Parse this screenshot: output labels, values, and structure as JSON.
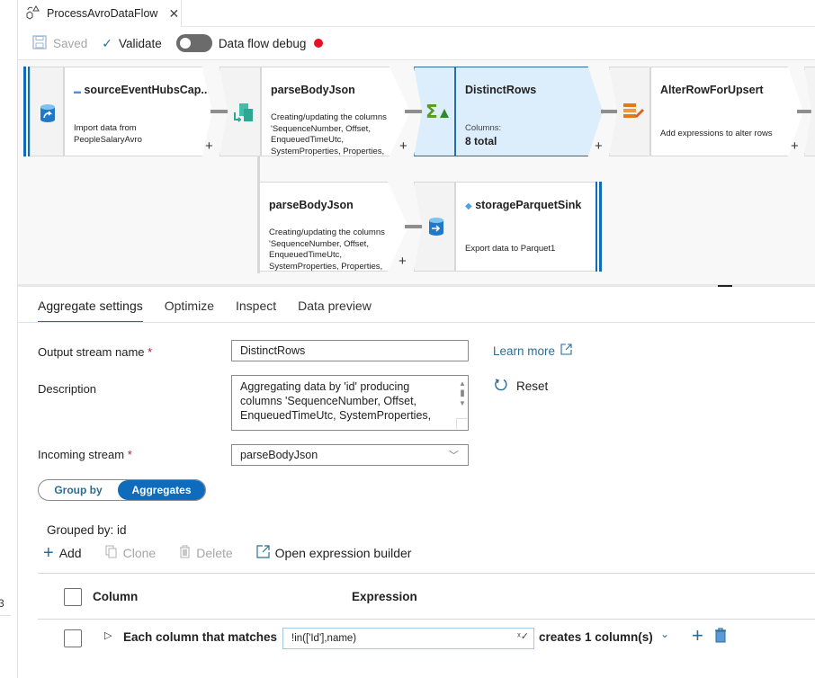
{
  "tab": {
    "title": "ProcessAvroDataFlow",
    "icon": "dataflow-icon",
    "close_icon": "close-icon"
  },
  "toolbar": {
    "saved_label": "Saved",
    "validate_label": "Validate",
    "debug_label": "Data flow debug",
    "debug_on": false,
    "debug_status_color": "#e81123"
  },
  "canvas": {
    "nodes": [
      {
        "id": "source",
        "title": "sourceEventHubsCap...",
        "desc": [
          "Import data from",
          "PeopleSalaryAvro"
        ],
        "icon": "source-database-icon"
      },
      {
        "id": "parse1",
        "title": "parseBodyJson",
        "desc": [
          "Creating/updating the columns",
          "'SequenceNumber, Offset,",
          "EnqueuedTimeUtc,",
          "SystemProperties, Properties,"
        ],
        "icon": "parse-icon"
      },
      {
        "id": "distinct",
        "title": "DistinctRows",
        "desc_label": "Columns:",
        "desc_value": "8 total",
        "icon": "aggregate-icon",
        "selected": true
      },
      {
        "id": "alterrow",
        "title": "AlterRowForUpsert",
        "desc": [
          "Add expressions to alter rows"
        ],
        "icon": "alter-row-icon"
      },
      {
        "id": "parse2",
        "title": "parseBodyJson",
        "desc": [
          "Creating/updating the columns",
          "'SequenceNumber, Offset,",
          "EnqueuedTimeUtc,",
          "SystemProperties, Properties,"
        ]
      },
      {
        "id": "sink",
        "title": "storageParquetSink",
        "desc": [
          "Export data to Parquet1"
        ],
        "icon": "sink-database-icon"
      }
    ],
    "plus_label": "+"
  },
  "panel": {
    "tabs": [
      "Aggregate settings",
      "Optimize",
      "Inspect",
      "Data preview"
    ],
    "active_tab": 0,
    "output_stream_label": "Output stream name",
    "output_stream_value": "DistinctRows",
    "required_mark": "*",
    "learn_more": "Learn more",
    "description_label": "Description",
    "description_lines": [
      "Aggregating data by 'id' producing",
      "columns 'SequenceNumber, Offset,",
      "EnqueuedTimeUtc, SystemProperties,"
    ],
    "reset_label": "Reset",
    "incoming_stream_label": "Incoming stream",
    "incoming_stream_value": "parseBodyJson",
    "segment": {
      "group_by": "Group by",
      "aggregates": "Aggregates",
      "active": "Aggregates"
    },
    "grouped_by": "Grouped by: id",
    "actions": {
      "add": "Add",
      "clone": "Clone",
      "delete": "Delete",
      "open_builder": "Open expression builder"
    },
    "table": {
      "col_column": "Column",
      "col_expression": "Expression",
      "rows": [
        {
          "label": "Each column that matches",
          "match_expr": "!in(['Id'],name)",
          "result": "creates 1 column(s)"
        }
      ]
    }
  },
  "left_fragment": "3"
}
